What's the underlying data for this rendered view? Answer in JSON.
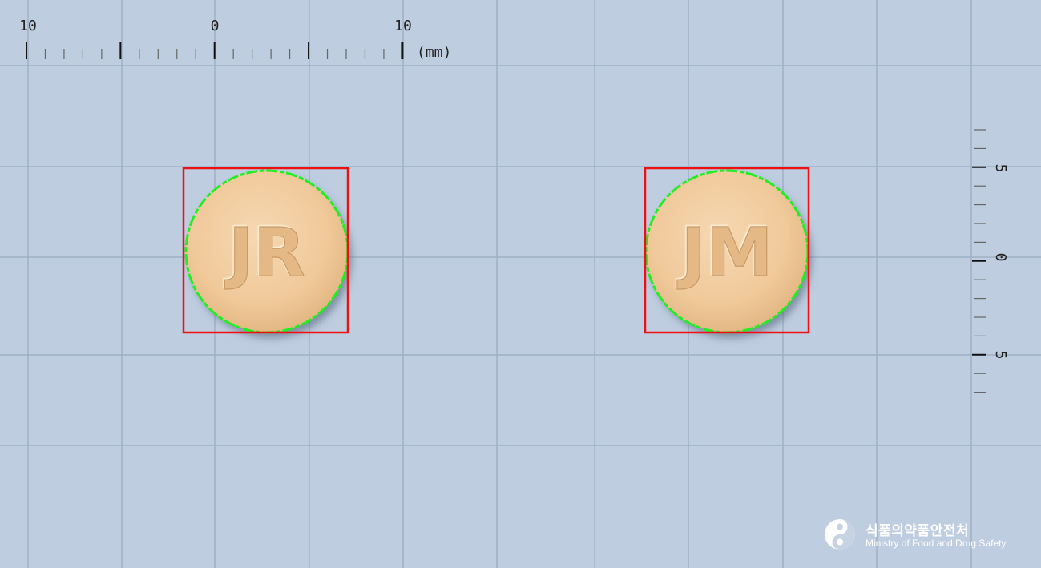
{
  "ruler_top": {
    "labels": [
      "10",
      "0",
      "10"
    ],
    "unit": "(mm)"
  },
  "ruler_right": {
    "labels": [
      "5",
      "0",
      "5"
    ]
  },
  "pills": [
    {
      "imprint": "JR",
      "color": "#f2cc9e"
    },
    {
      "imprint": "JM",
      "color": "#f2cc9e"
    }
  ],
  "colors": {
    "background": "#bfcde0",
    "grid": "#9fb0c6",
    "bounding_box": "#ee1111",
    "contour": "#22ee22",
    "pill": "#f2cc9e"
  },
  "logo": {
    "icon": "mfds-swirl-logo-icon",
    "korean": "식품의약품안전처",
    "english": "Ministry of Food and Drug Safety"
  }
}
